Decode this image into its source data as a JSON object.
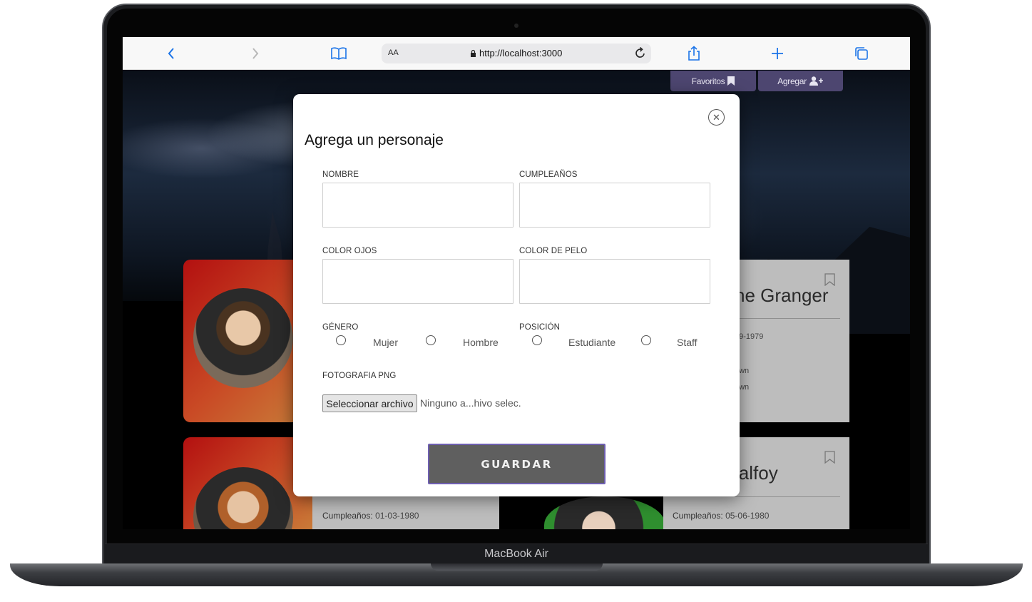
{
  "device": {
    "label": "MacBook Air"
  },
  "browser": {
    "aa_label": "AA",
    "url": "http://localhost:3000",
    "icons": [
      "back-chevron-icon",
      "forward-chevron-icon",
      "book-icon",
      "lock-icon",
      "reload-icon",
      "share-icon",
      "plus-icon",
      "tabs-icon"
    ]
  },
  "header": {
    "favorites_label": "Favoritos",
    "add_label": "Agregar",
    "accent_color": "#4d4670"
  },
  "cards": [
    {
      "name_partial": "ne Granger",
      "birthday_partial": "09-1979",
      "line2_partial": "own",
      "line3_partial": "own"
    },
    {
      "name_partial": "lalfoy",
      "birthday_label": "Cumpleaños:",
      "birthday_value": "05-06-1980"
    },
    {
      "birthday_label": "Cumpleaños:",
      "birthday_value": "01-03-1980"
    }
  ],
  "modal": {
    "title": "Agrega un personaje",
    "fields": {
      "nombre": {
        "label": "NOMBRE",
        "value": ""
      },
      "cumpleanos": {
        "label": "CUMPLEAÑOS",
        "value": ""
      },
      "color_ojos": {
        "label": "COLOR OJOS",
        "value": ""
      },
      "color_pelo": {
        "label": "COLOR DE PELO",
        "value": ""
      }
    },
    "genero": {
      "label": "GÉNERO",
      "options": [
        "Mujer",
        "Hombre"
      ]
    },
    "posicion": {
      "label": "POSICIÓN",
      "options": [
        "Estudiante",
        "Staff"
      ]
    },
    "foto": {
      "label": "FOTOGRAFIA PNG",
      "button": "Seleccionar archivo",
      "status": "Ninguno a...hivo selec."
    },
    "save_label": "GUARDAR",
    "save_border_color": "#6e5fb0"
  }
}
